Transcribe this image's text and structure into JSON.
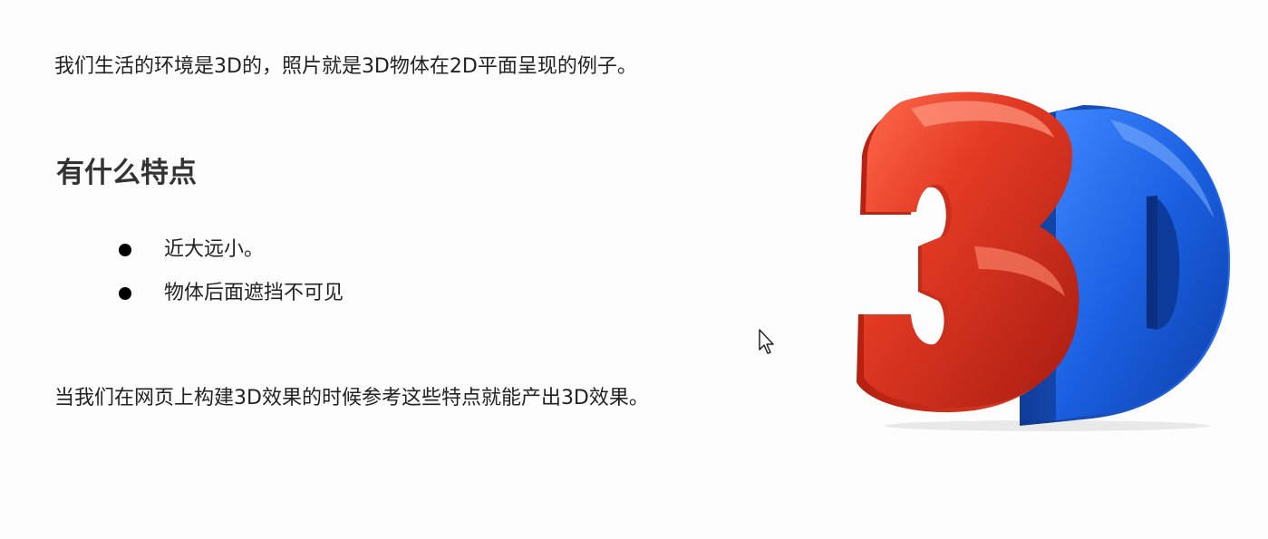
{
  "intro_text": "我们生活的环境是3D的，照片就是3D物体在2D平面呈现的例子。",
  "section_heading": "有什么特点",
  "bullets": [
    {
      "text": "近大远小。"
    },
    {
      "text": "物体后面遮挡不可见"
    }
  ],
  "closing_text": "当我们在网页上构建3D效果的时候参考这些特点就能产出3D效果。",
  "image": {
    "label": "3D",
    "icon": "3d-logo-image",
    "colors": {
      "three_red": "#e43b24",
      "d_blue": "#1a5fe0"
    }
  },
  "cursor": {
    "icon": "mouse-pointer-icon"
  }
}
